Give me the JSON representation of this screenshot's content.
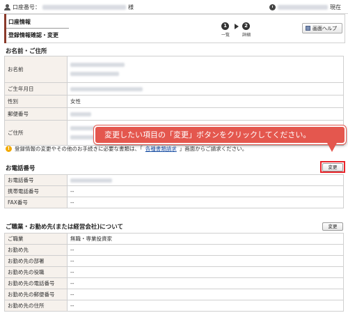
{
  "topbar": {
    "account_label": "口座番号：",
    "account_suffix": "様",
    "time_suffix": "現在"
  },
  "header": {
    "section": "口座情報",
    "page_title": "登録情報確認・変更",
    "steps": [
      {
        "num": "1",
        "label": "一覧"
      },
      {
        "num": "2",
        "label": "詳細"
      }
    ],
    "help_button": "画面ヘルプ"
  },
  "name_section": {
    "title": "お名前・ご住所",
    "rows": [
      {
        "label": "お名前",
        "value": ""
      },
      {
        "label": "ご生年月日",
        "value": ""
      },
      {
        "label": "性別",
        "value": "女性"
      },
      {
        "label": "郵便番号",
        "value": ""
      },
      {
        "label": "ご住所",
        "value": ""
      }
    ]
  },
  "info_message": {
    "before": "登録情報の変更やその他のお手続きに必要な書類は、「",
    "link": "各種書類請求",
    "after": "」画面からご請求ください。"
  },
  "tooltip": {
    "text": "変更したい項目の「変更」ボタンをクリックしてください。",
    "accent_color": "#e4574e"
  },
  "phone_section": {
    "title": "お電話番号",
    "change_button": "変更",
    "rows": [
      {
        "label": "お電話番号",
        "value": ""
      },
      {
        "label": "携帯電話番号",
        "value": "--"
      },
      {
        "label": "FAX番号",
        "value": "--"
      }
    ]
  },
  "job_section": {
    "title": "ご職業・お勤め先(または経営会社)について",
    "change_button": "変更",
    "rows": [
      {
        "label": "ご職業",
        "value": "無職・専業投資家"
      },
      {
        "label": "お勤め先",
        "value": "--"
      },
      {
        "label": "お勤め先の部署",
        "value": "--"
      },
      {
        "label": "お勤め先の役職",
        "value": "--"
      },
      {
        "label": "お勤め先の電話番号",
        "value": "--"
      },
      {
        "label": "お勤め先の郵便番号",
        "value": "--"
      },
      {
        "label": "お勤め先の住所",
        "value": "--"
      }
    ]
  },
  "icons": [
    "person-icon",
    "clock-icon",
    "book-icon",
    "info-icon"
  ],
  "colors": {
    "header_accent": "#8a3a2a",
    "label_bg": "#f6f1ec",
    "highlight": "#e8242a",
    "link": "#1a4fa3"
  }
}
